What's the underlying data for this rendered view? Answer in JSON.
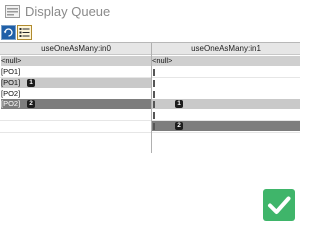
{
  "window": {
    "title": "Display Queue"
  },
  "toolbar": {
    "refresh_icon": "refresh-icon",
    "list_icon": "list-icon"
  },
  "grid": {
    "columns": [
      "useOneAsMany:in0",
      "useOneAsMany:in1"
    ],
    "rows": [
      {
        "c0": "<null>",
        "c1": "<null>",
        "c0_badge": "",
        "c1_badge": ""
      },
      {
        "c0": "[PO1]",
        "c1": "",
        "c0_badge": "",
        "c1_badge": ""
      },
      {
        "c0": "[PO1]",
        "c1": "",
        "c0_badge": "1",
        "c1_badge": ""
      },
      {
        "c0": "[PO2]",
        "c1": "",
        "c0_badge": "",
        "c1_badge": ""
      },
      {
        "c0": "[PO2]",
        "c1": "",
        "c0_badge": "2",
        "c1_badge": "1"
      },
      {
        "c0": "",
        "c1": "",
        "c0_badge": "",
        "c1_badge": ""
      },
      {
        "c0": "",
        "c1": "",
        "c0_badge": "",
        "c1_badge": "2"
      }
    ]
  },
  "confirm": {
    "icon": "checkmark-icon",
    "color": "#3fb56a"
  }
}
